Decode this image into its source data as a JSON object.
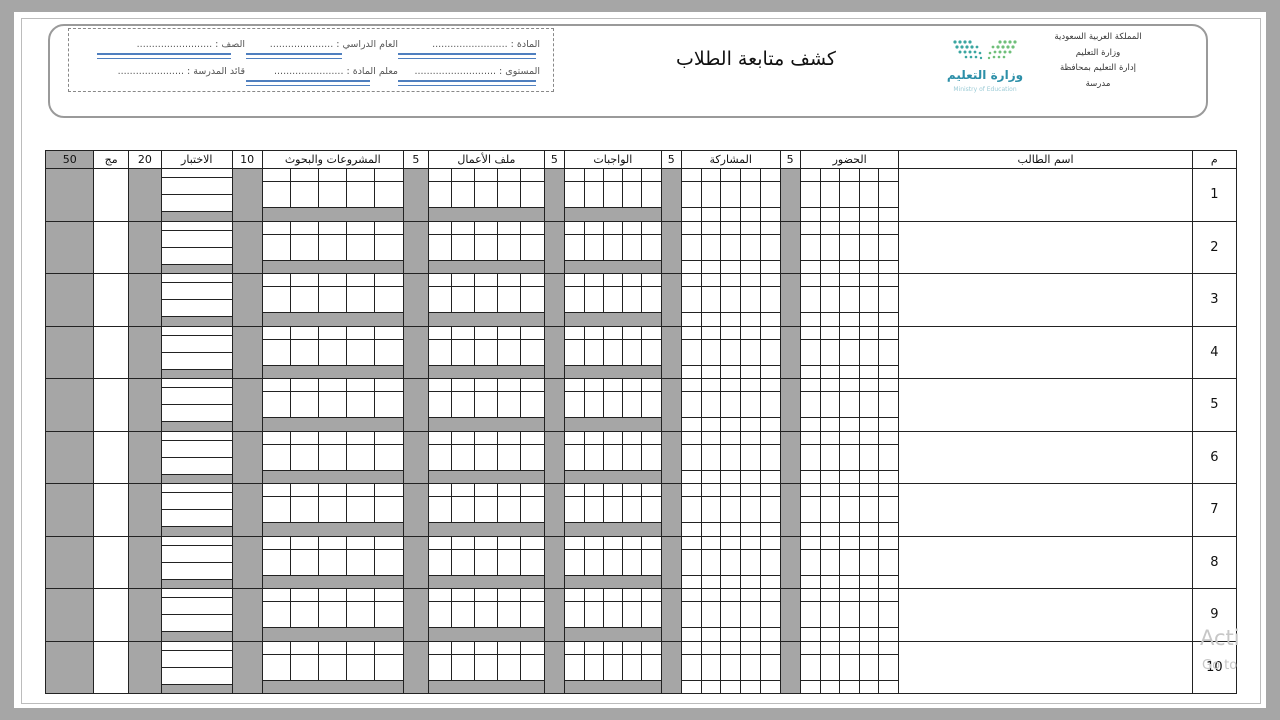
{
  "document": {
    "title": "كشف متابعة الطلاب",
    "ministry_lines": [
      "المملكة العربية السعودية",
      "وزارة التعليم",
      "إدارة التعليم بمحافظة",
      "مدرسة"
    ],
    "logo": {
      "text": "وزارة التعليم",
      "subtext": "Ministry of Education",
      "color": "#2c8fa8",
      "icon": "ministry-logo-icon"
    },
    "info": {
      "row1_right": "المادة : .........................",
      "row1_mid": "العام الدراسي : .....................",
      "row1_left": "الصف : .........................",
      "row2_right": "المستوى : ...........................",
      "row2_mid": "معلم المادة : .......................",
      "row2_left": "قائد المدرسة : ......................"
    }
  },
  "table": {
    "headers": {
      "number": "م",
      "student_name": "اسم الطالب",
      "attendance": "الحضور",
      "attendance_max": "5",
      "participation": "المشاركة",
      "participation_max": "5",
      "homework": "الواجبات",
      "homework_max": "5",
      "portfolio": "ملف الأعمال",
      "portfolio_max": "5",
      "projects": "المشروعات والبحوث",
      "projects_max": "10",
      "exam": "الاختبار",
      "exam_max": "20",
      "total": "مج",
      "grand_max": "50"
    },
    "rows": [
      "1",
      "2",
      "3",
      "4",
      "5",
      "6",
      "7",
      "8",
      "9",
      "10"
    ],
    "shade_color": "#a6a6a6"
  },
  "watermark": {
    "line1": "Acti",
    "line2": "Go to"
  }
}
